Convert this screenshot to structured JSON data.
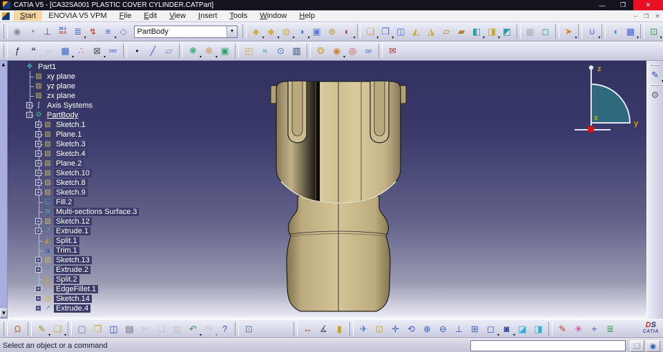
{
  "window": {
    "title": "CATIA V5 - [CA32SA001 PLASTIC COVER CYLINDER.CATPart]",
    "controls": {
      "minimize": "—",
      "maximize": "❐",
      "close": "✕"
    }
  },
  "menu": {
    "items": [
      {
        "label": "Start",
        "active": true,
        "u": 1
      },
      {
        "label": "ENOVIA V5 VPM",
        "u": 0
      },
      {
        "label": "File",
        "u": 1
      },
      {
        "label": "Edit",
        "u": 1
      },
      {
        "label": "View",
        "u": 1
      },
      {
        "label": "Insert",
        "u": 1
      },
      {
        "label": "Tools",
        "u": 1
      },
      {
        "label": "Window",
        "u": 1
      },
      {
        "label": "Help",
        "u": 1
      }
    ],
    "child_controls": [
      "–",
      "❐",
      "✕"
    ]
  },
  "combo": {
    "value": "PartBody"
  },
  "toolbars": {
    "top1": [
      {
        "t": "sep"
      },
      {
        "n": "spiral-curve-icon",
        "g": "◉",
        "c": "#8a8a9c"
      },
      {
        "n": "globe-hand-icon",
        "g": "◔",
        "c": "#7a7a8c"
      },
      {
        "n": "axis-system-icon",
        "g": "⊥",
        "c": "#44507a"
      },
      {
        "n": "dimension-tolerance-icon",
        "g": "10.1",
        "g2": "10.0",
        "c": "#22409c",
        "c2": "#c03020"
      },
      {
        "n": "stack-icon",
        "g": "≣",
        "c": "#3a5fc8",
        "d": 1
      },
      {
        "n": "bolt-icon",
        "g": "↯",
        "c": "#d03020"
      },
      {
        "n": "list-icon",
        "g": "≡",
        "c": "#3a5fc8",
        "d": 1
      },
      {
        "n": "pad-diamond-icon",
        "g": "◇",
        "c": "#6688cc"
      },
      {
        "t": "combo"
      },
      {
        "t": "sep"
      },
      {
        "n": "extrude-surface-icon",
        "g": "◈",
        "c": "#c9a832",
        "d": 1
      },
      {
        "n": "revolve-surface-icon",
        "g": "◆",
        "c": "#d4b24a",
        "d": 1
      },
      {
        "n": "sphere-surface-icon",
        "g": "◍",
        "c": "#d4b24a",
        "d": 1
      },
      {
        "n": "offset-surface-icon",
        "g": "◑",
        "c": "#4a6fd4",
        "d": 1
      },
      {
        "n": "sweep-surface-icon",
        "g": "▣",
        "c": "#5a7ad4"
      },
      {
        "n": "fill-surface-icon",
        "g": "⊛",
        "c": "#b0a040"
      },
      {
        "n": "multi-sections-surface-icon",
        "g": "◐",
        "c": "#c04030",
        "d": 1
      },
      {
        "t": "sep"
      },
      {
        "n": "join-icon",
        "g": "❏",
        "c": "#c9a832",
        "d": 1
      },
      {
        "n": "healing-icon",
        "g": "❐",
        "c": "#4a6fd4",
        "d": 1
      },
      {
        "n": "untrim-icon",
        "g": "◫",
        "c": "#4a6fd4"
      },
      {
        "n": "split-icon",
        "g": "◭",
        "c": "#c9a832"
      },
      {
        "n": "trim-icon",
        "g": "◮",
        "c": "#c9a832"
      },
      {
        "n": "boundary-icon",
        "g": "▱",
        "c": "#b08030"
      },
      {
        "n": "extract-icon",
        "g": "▰",
        "c": "#b08030"
      },
      {
        "n": "shape-fillet-icon",
        "g": "◧",
        "c": "#2aa0a0",
        "d": 1
      },
      {
        "n": "translate-icon",
        "g": "◨",
        "c": "#c9a832",
        "d": 1
      },
      {
        "n": "symmetry-icon",
        "g": "◩",
        "c": "#2aa0a0"
      },
      {
        "t": "sep"
      },
      {
        "n": "constraints-icon",
        "g": "▦",
        "c": "#667",
        "x": 1
      },
      {
        "n": "constraint-box-icon",
        "g": "◻",
        "c": "#2aa0a0"
      },
      {
        "t": "sep"
      },
      {
        "n": "select-arrow-icon",
        "g": "➤",
        "c": "#e08020",
        "d": 1
      },
      {
        "t": "sep"
      },
      {
        "n": "power-copy-icon",
        "g": "∪",
        "c": "#4a6fd4",
        "d": 1
      },
      {
        "t": "sep"
      },
      {
        "n": "symmetry-shell-icon",
        "g": "◖",
        "c": "#3a8fd4"
      },
      {
        "n": "grid-icon",
        "g": "▦",
        "c": "#4a5fd4",
        "d": 1
      },
      {
        "t": "sep"
      },
      {
        "n": "quick-zoom-icon",
        "g": "⊡",
        "c": "#2aa040",
        "d": 1
      }
    ],
    "top2": [
      {
        "t": "sep"
      },
      {
        "n": "formula-icon",
        "g": "ƒ",
        "c": "#222"
      },
      {
        "n": "comment-icon",
        "g": "❝",
        "c": "#667"
      },
      {
        "n": "link-icon",
        "g": "∞",
        "c": "#99a",
        "x": 1
      },
      {
        "n": "design-table-icon",
        "g": "▦",
        "c": "#3a5fc8",
        "d": 1
      },
      {
        "n": "relations-icon",
        "g": "∴",
        "c": "#c05070"
      },
      {
        "n": "lock-icon",
        "g": "⊠",
        "c": "#555",
        "d": 1
      },
      {
        "n": "equivalent-dimensions-icon",
        "g": "≔",
        "c": "#3a5fc8"
      },
      {
        "t": "sep"
      },
      {
        "n": "point-icon",
        "g": "•",
        "c": "#223"
      },
      {
        "n": "line-icon",
        "g": "╱",
        "c": "#3a5fc8"
      },
      {
        "n": "plane-icon",
        "g": "▱",
        "c": "#6a8ad4"
      },
      {
        "t": "sep"
      },
      {
        "n": "catalog-browser-icon",
        "g": "❋",
        "c": "#2aa070",
        "d": 1
      },
      {
        "n": "user-feature-icon",
        "g": "❊",
        "c": "#d08030",
        "d": 1
      },
      {
        "n": "document-template-icon",
        "g": "▣",
        "c": "#2aa070"
      },
      {
        "t": "sep"
      },
      {
        "n": "extrude-volume-icon",
        "g": "◰",
        "c": "#c9a832"
      },
      {
        "n": "wave-surface-icon",
        "g": "≈",
        "c": "#2aa0a0"
      },
      {
        "n": "cylinder-icon",
        "g": "⊙",
        "c": "#4a6fd4"
      },
      {
        "n": "thick-surface-icon",
        "g": "▥",
        "c": "#224466"
      },
      {
        "t": "sep"
      },
      {
        "n": "develop-icon",
        "g": "❂",
        "c": "#c9a832"
      },
      {
        "n": "unfold-icon",
        "g": "◉",
        "c": "#d08030",
        "d": 1
      },
      {
        "n": "transfer-icon",
        "g": "◎",
        "c": "#c05040"
      },
      {
        "n": "junction-icon",
        "g": "∞",
        "c": "#4a6fd4"
      },
      {
        "t": "sep"
      },
      {
        "n": "send-to-icon",
        "g": "✉",
        "c": "#b03030"
      }
    ],
    "bottom": [
      {
        "t": "sep"
      },
      {
        "n": "workbench-icon",
        "g": "Ω",
        "c": "#c06020"
      },
      {
        "t": "sep"
      },
      {
        "n": "sketcher-icon",
        "g": "✎",
        "c": "#b09020",
        "d": 1
      },
      {
        "n": "exit-workbench-icon",
        "g": "❏",
        "c": "#c9a832",
        "d": 1
      },
      {
        "t": "sep"
      },
      {
        "n": "new-document-icon",
        "g": "▢",
        "c": "#778"
      },
      {
        "n": "open-icon",
        "g": "❐",
        "c": "#d8a020"
      },
      {
        "n": "save-icon",
        "g": "◫",
        "c": "#3050b0"
      },
      {
        "n": "print-icon",
        "g": "▤",
        "c": "#667"
      },
      {
        "n": "cut-icon",
        "g": "✂",
        "c": "#99a",
        "x": 1
      },
      {
        "n": "copy-icon",
        "g": "❏",
        "c": "#99a",
        "x": 1
      },
      {
        "n": "paste-icon",
        "g": "▥",
        "c": "#99a",
        "x": 1
      },
      {
        "n": "undo-icon",
        "g": "↶",
        "c": "#2a9040",
        "d": 1
      },
      {
        "n": "redo-icon",
        "g": "↷",
        "c": "#99a",
        "d": 1,
        "x": 1
      },
      {
        "n": "whats-this-icon",
        "g": "?",
        "c": "#3050b0"
      },
      {
        "t": "sep"
      },
      {
        "n": "print-whole-document-icon",
        "g": "⊡",
        "c": "#5a7a9a"
      },
      {
        "t": "gap",
        "w": 50
      },
      {
        "t": "sep"
      },
      {
        "n": "measure-between-icon",
        "g": "↔",
        "c": "#c04030"
      },
      {
        "n": "measure-item-icon",
        "g": "∡",
        "c": "#556"
      },
      {
        "n": "measure-inertia-icon",
        "g": "▮",
        "c": "#c9a020"
      },
      {
        "t": "sep"
      },
      {
        "n": "fly-mode-icon",
        "g": "✈",
        "c": "#3a6fd4"
      },
      {
        "n": "fit-all-in-icon",
        "g": "⊡",
        "c": "#c9a832"
      },
      {
        "n": "pan-icon",
        "g": "✛",
        "c": "#3a5fc8"
      },
      {
        "n": "rotate-icon",
        "g": "⟲",
        "c": "#3a5fc8"
      },
      {
        "n": "zoom-in-icon",
        "g": "⊕",
        "c": "#3a5fc8"
      },
      {
        "n": "zoom-out-icon",
        "g": "⊖",
        "c": "#3a5fc8"
      },
      {
        "n": "normal-view-icon",
        "g": "⊥",
        "c": "#3a5fc8"
      },
      {
        "n": "multi-view-icon",
        "g": "⊞",
        "c": "#3a5fc8"
      },
      {
        "n": "iso-view-icon",
        "g": "◻",
        "c": "#3a5fc8",
        "d": 1
      },
      {
        "n": "render-style-icon",
        "g": "◙",
        "c": "#2a3f9f",
        "d": 1
      },
      {
        "n": "hide-show-icon",
        "g": "◪",
        "c": "#2ab0d0"
      },
      {
        "n": "swap-visible-space-icon",
        "g": "◨",
        "c": "#2ab0d0"
      },
      {
        "t": "sep"
      },
      {
        "n": "pen-annotation-icon",
        "g": "✎",
        "c": "#c04030"
      },
      {
        "n": "apply-material-icon",
        "g": "✳",
        "c": "#c030a0"
      },
      {
        "n": "compass-manipulation-icon",
        "g": "⌖",
        "c": "#3a5fc8"
      },
      {
        "n": "layer-filter-icon",
        "g": "≣",
        "c": "#2a9040"
      }
    ],
    "right": [
      {
        "n": "sketch-tracer-icon",
        "g": "✎",
        "c": "#3050b0",
        "d": 1
      },
      {
        "n": "gear-options-icon",
        "g": "⚙",
        "c": "#667"
      }
    ]
  },
  "tree": {
    "items": [
      {
        "label": "Part1",
        "icon": "part-icon",
        "g": "❖",
        "c": "#3ab0c0",
        "level": 0
      },
      {
        "label": "xy plane",
        "icon": "plane-icon",
        "g": "▨",
        "c": "#c8b860",
        "level": 1
      },
      {
        "label": "yz plane",
        "icon": "plane-icon",
        "g": "▨",
        "c": "#c8b860",
        "level": 1
      },
      {
        "label": "zx plane",
        "icon": "plane-icon",
        "g": "▨",
        "c": "#c8b860",
        "level": 1
      },
      {
        "label": "Axis Systems",
        "icon": "axis-systems-icon",
        "g": "ʃ",
        "c": "#dde",
        "level": 1,
        "expandable": true
      },
      {
        "label": "PartBody",
        "icon": "partbody-icon",
        "g": "⚙",
        "c": "#3ac080",
        "level": 1,
        "expandable": true,
        "expanded": true,
        "underline": true
      },
      {
        "label": "Sketch.1",
        "icon": "sketch-icon",
        "g": "▧",
        "c": "#c8b860",
        "level": 2,
        "selected": true,
        "expandable": true
      },
      {
        "label": "Plane.1",
        "icon": "plane-feature-icon",
        "g": "▨",
        "c": "#c8b860",
        "level": 2,
        "selected": true,
        "expandable": true
      },
      {
        "label": "Sketch.3",
        "icon": "sketch-icon",
        "g": "▧",
        "c": "#c8b860",
        "level": 2,
        "selected": true,
        "expandable": true
      },
      {
        "label": "Sketch.4",
        "icon": "sketch-icon",
        "g": "▧",
        "c": "#c8b860",
        "level": 2,
        "selected": true,
        "expandable": true
      },
      {
        "label": "Plane.2",
        "icon": "plane-feature-icon",
        "g": "▨",
        "c": "#c8b860",
        "level": 2,
        "selected": true,
        "expandable": true
      },
      {
        "label": "Sketch.10",
        "icon": "sketch-icon",
        "g": "▧",
        "c": "#c8b860",
        "level": 2,
        "selected": true,
        "expandable": true
      },
      {
        "label": "Sketch.8",
        "icon": "sketch-icon",
        "g": "▧",
        "c": "#c8b860",
        "level": 2,
        "selected": true,
        "expandable": true
      },
      {
        "label": "Sketch.9",
        "icon": "sketch-icon",
        "g": "▧",
        "c": "#c8b860",
        "level": 2,
        "selected": true,
        "expandable": true
      },
      {
        "label": "Fill.2",
        "icon": "fill-icon",
        "g": "◱",
        "c": "#30b0c0",
        "level": 2,
        "selected": true
      },
      {
        "label": "Multi-sections Surface.3",
        "icon": "multi-sections-surface-icon",
        "g": "≋",
        "c": "#30c0c0",
        "level": 2,
        "selected": true
      },
      {
        "label": "Sketch.12",
        "icon": "sketch-icon",
        "g": "▧",
        "c": "#c8b860",
        "level": 2,
        "selected": true,
        "expandable": true
      },
      {
        "label": "Extrude.1",
        "icon": "extrude-icon",
        "g": "↗",
        "c": "#30b0a0",
        "level": 2,
        "selected": true,
        "expandable": true
      },
      {
        "label": "Split.1",
        "icon": "split-icon",
        "g": "◭",
        "c": "#c8a030",
        "level": 2,
        "selected": true
      },
      {
        "label": "Trim.1",
        "icon": "trim-icon",
        "g": "◮",
        "c": "#3060c0",
        "level": 2,
        "selected": true
      },
      {
        "label": "Sketch.13",
        "icon": "sketch-icon",
        "g": "▧",
        "c": "#c8b860",
        "level": 2,
        "selected": true,
        "expandable": true
      },
      {
        "label": "Extrude.2",
        "icon": "extrude-icon",
        "g": "↗",
        "c": "#30b0a0",
        "level": 2,
        "selected": true,
        "expandable": true
      },
      {
        "label": "Split.2",
        "icon": "split-icon",
        "g": "◭",
        "c": "#c8a030",
        "level": 2,
        "selected": true
      },
      {
        "label": "EdgeFillet.1",
        "icon": "edge-fillet-icon",
        "g": "⌒",
        "c": "#d0a020",
        "level": 2,
        "selected": true,
        "expandable": true
      },
      {
        "label": "Sketch.14",
        "icon": "sketch-icon",
        "g": "▧",
        "c": "#c8b860",
        "level": 2,
        "selected": true,
        "expandable": true
      },
      {
        "label": "Extrude.4",
        "icon": "extrude-icon",
        "g": "↗",
        "c": "#30b0a0",
        "level": 2,
        "selected": true,
        "expandable": true
      }
    ]
  },
  "compass": {
    "x": "x",
    "y": "y",
    "z": "z"
  },
  "viewport": {
    "model_name": "plastic-cover-cylinder",
    "body_color": "#cdbd93",
    "edge_color": "#1c1c1c"
  },
  "status": {
    "message": "Select an object or a command"
  },
  "brand": {
    "ds": "DS",
    "name": "CATIA"
  }
}
